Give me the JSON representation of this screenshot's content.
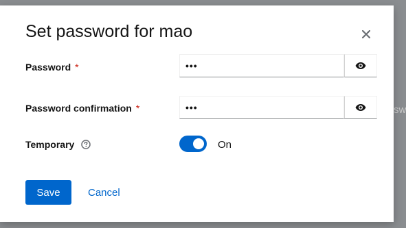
{
  "backdrop": {
    "partial_text": "swo"
  },
  "modal": {
    "title": "Set password for mao",
    "close_icon": "close-icon"
  },
  "form": {
    "password": {
      "label": "Password",
      "required_mark": "*",
      "value": "•••",
      "toggle_icon": "eye-icon"
    },
    "password_confirmation": {
      "label": "Password confirmation",
      "required_mark": "*",
      "value": "•••",
      "toggle_icon": "eye-icon"
    },
    "temporary": {
      "label": "Temporary",
      "help_icon": "help-icon",
      "state_label": "On",
      "checked": true
    }
  },
  "footer": {
    "save_label": "Save",
    "cancel_label": "Cancel"
  },
  "colors": {
    "primary": "#0066cc",
    "required": "#c9190b",
    "backdrop": "#8a8d90"
  }
}
